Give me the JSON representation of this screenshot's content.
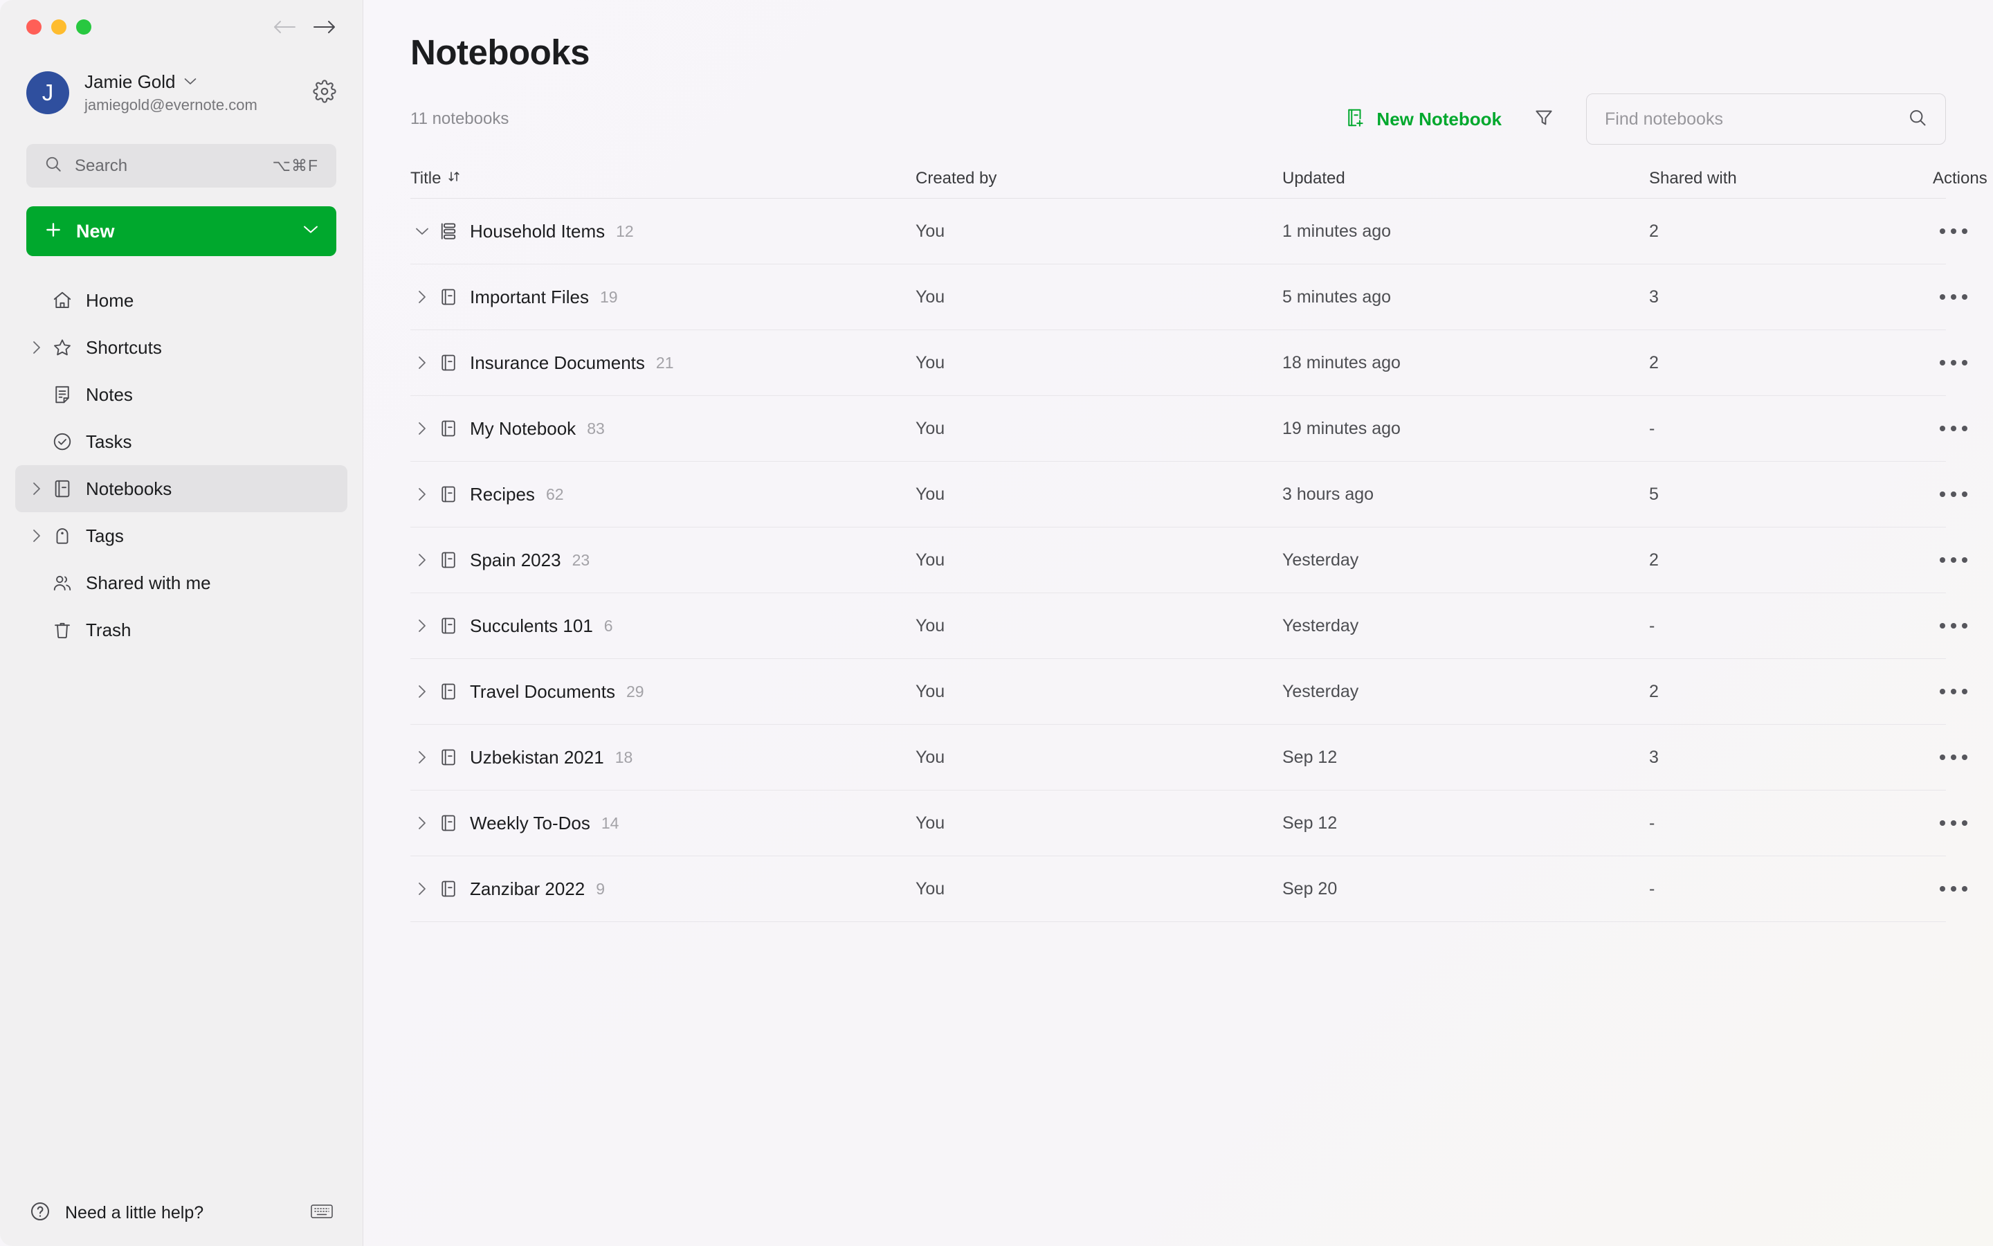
{
  "window": {
    "traffic_lights": [
      "close",
      "minimize",
      "maximize"
    ],
    "nav_back": "back-arrow",
    "nav_forward": "forward-arrow"
  },
  "sidebar": {
    "account": {
      "avatar_initial": "J",
      "name": "Jamie Gold",
      "email": "jamiegold@evernote.com",
      "settings_icon": "gear-icon",
      "chevron": "chevron-down-icon"
    },
    "search": {
      "placeholder": "Search",
      "shortcut": "⌥⌘F",
      "icon": "search-icon"
    },
    "new_button": {
      "label": "New",
      "plus_icon": "plus-icon",
      "caret_icon": "chevron-down-icon",
      "color": "#00a82d"
    },
    "items": [
      {
        "label": "Home",
        "icon": "home-icon",
        "expandable": false,
        "active": false
      },
      {
        "label": "Shortcuts",
        "icon": "star-icon",
        "expandable": true,
        "active": false
      },
      {
        "label": "Notes",
        "icon": "note-icon",
        "expandable": false,
        "active": false
      },
      {
        "label": "Tasks",
        "icon": "check-circle-icon",
        "expandable": false,
        "active": false
      },
      {
        "label": "Notebooks",
        "icon": "notebook-icon",
        "expandable": true,
        "active": true
      },
      {
        "label": "Tags",
        "icon": "tag-icon",
        "expandable": true,
        "active": false
      },
      {
        "label": "Shared with me",
        "icon": "people-icon",
        "expandable": false,
        "active": false
      },
      {
        "label": "Trash",
        "icon": "trash-icon",
        "expandable": false,
        "active": false
      }
    ],
    "help": {
      "label": "Need a little help?",
      "icon": "question-circle-icon",
      "keyboard_icon": "keyboard-icon"
    }
  },
  "main": {
    "title": "Notebooks",
    "count_label": "11 notebooks",
    "new_notebook": {
      "label": "New Notebook",
      "icon": "new-notebook-icon",
      "color": "#00a82d"
    },
    "filter_icon": "filter-icon",
    "find": {
      "placeholder": "Find notebooks",
      "value": "",
      "icon": "search-icon"
    },
    "table": {
      "columns": [
        {
          "key": "title",
          "label": "Title",
          "sort_icon": "sort-arrows-icon"
        },
        {
          "key": "author",
          "label": "Created by"
        },
        {
          "key": "updated",
          "label": "Updated"
        },
        {
          "key": "shared",
          "label": "Shared with"
        },
        {
          "key": "actions",
          "label": "Actions"
        }
      ],
      "rows": [
        {
          "title": "Household Items",
          "count": "12",
          "author": "You",
          "updated": "1 minutes ago",
          "shared": "2",
          "icon": "notebook-stack-icon",
          "expanded": true
        },
        {
          "title": "Important Files",
          "count": "19",
          "author": "You",
          "updated": "5 minutes ago",
          "shared": "3",
          "icon": "notebook-icon",
          "expanded": false
        },
        {
          "title": "Insurance Documents",
          "count": "21",
          "author": "You",
          "updated": "18 minutes ago",
          "shared": "2",
          "icon": "notebook-icon",
          "expanded": false
        },
        {
          "title": "My Notebook",
          "count": "83",
          "author": "You",
          "updated": "19 minutes ago",
          "shared": "-",
          "icon": "notebook-icon",
          "expanded": false
        },
        {
          "title": "Recipes",
          "count": "62",
          "author": "You",
          "updated": "3 hours ago",
          "shared": "5",
          "icon": "notebook-icon",
          "expanded": false
        },
        {
          "title": "Spain 2023",
          "count": "23",
          "author": "You",
          "updated": "Yesterday",
          "shared": "2",
          "icon": "notebook-icon",
          "expanded": false
        },
        {
          "title": "Succulents 101",
          "count": "6",
          "author": "You",
          "updated": "Yesterday",
          "shared": "-",
          "icon": "notebook-icon",
          "expanded": false
        },
        {
          "title": "Travel Documents",
          "count": "29",
          "author": "You",
          "updated": "Yesterday",
          "shared": "2",
          "icon": "notebook-icon",
          "expanded": false
        },
        {
          "title": "Uzbekistan 2021",
          "count": "18",
          "author": "You",
          "updated": "Sep 12",
          "shared": "3",
          "icon": "notebook-icon",
          "expanded": false
        },
        {
          "title": "Weekly To-Dos",
          "count": "14",
          "author": "You",
          "updated": "Sep 12",
          "shared": "-",
          "icon": "notebook-icon",
          "expanded": false
        },
        {
          "title": "Zanzibar 2022",
          "count": "9",
          "author": "You",
          "updated": "Sep 20",
          "shared": "-",
          "icon": "notebook-icon",
          "expanded": false
        }
      ]
    }
  }
}
